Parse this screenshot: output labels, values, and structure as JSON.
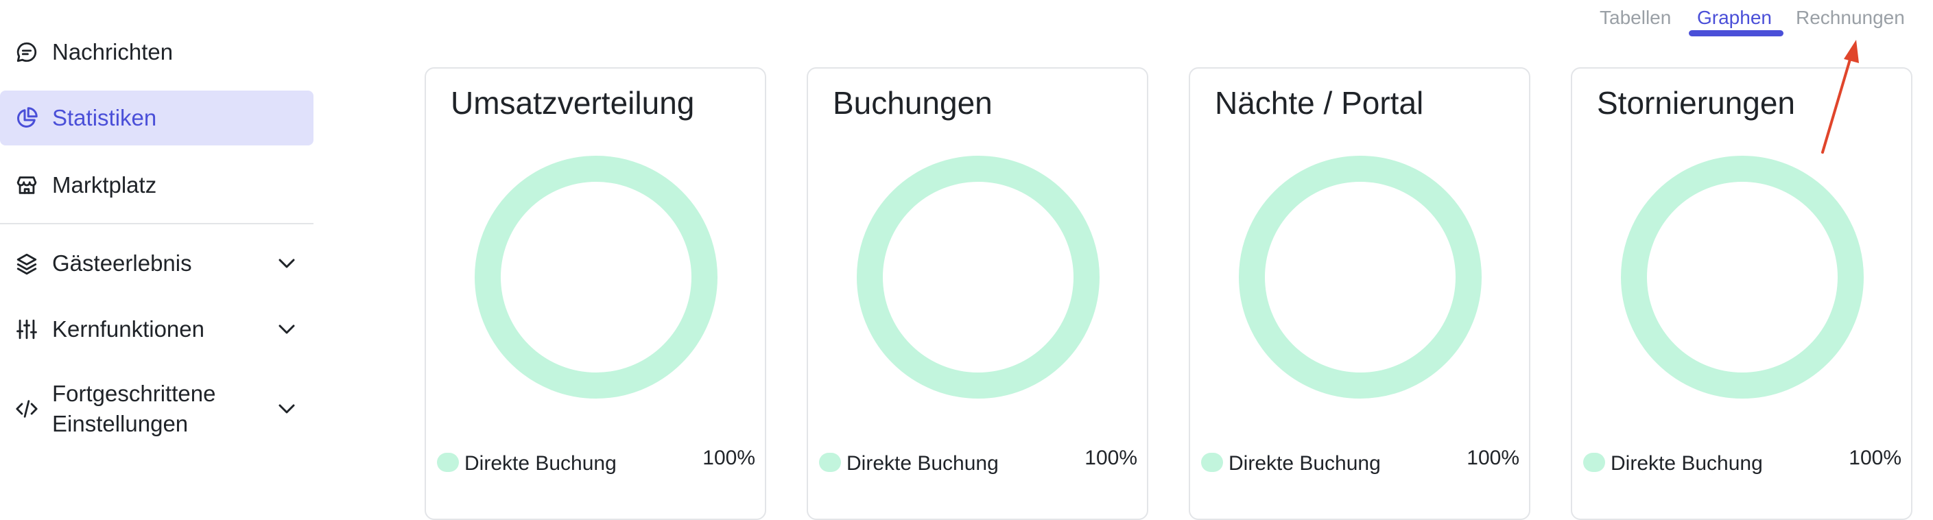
{
  "sidebar": {
    "items": [
      {
        "label": "Nachrichten",
        "icon": "chat-icon"
      },
      {
        "label": "Statistiken",
        "icon": "pie-chart-icon",
        "active": true
      },
      {
        "label": "Marktplatz",
        "icon": "store-icon"
      },
      {
        "label": "Gästeerlebnis",
        "icon": "layers-icon"
      },
      {
        "label": "Kernfunktionen",
        "icon": "sliders-icon"
      },
      {
        "label_line1": "Fortgeschrittene",
        "label_line2": "Einstellungen",
        "icon": "code-icon"
      }
    ]
  },
  "tabs": [
    {
      "label": "Tabellen"
    },
    {
      "label": "Graphen",
      "active": true
    },
    {
      "label": "Rechnungen"
    }
  ],
  "cards": [
    {
      "title": "Umsatzverteilung",
      "legend_label": "Direkte Buchung",
      "legend_value": "100%"
    },
    {
      "title": "Buchungen",
      "legend_label": "Direkte Buchung",
      "legend_value": "100%"
    },
    {
      "title": "Nächte / Portal",
      "legend_label": "Direkte Buchung",
      "legend_value": "100%"
    },
    {
      "title": "Stornierungen",
      "legend_label": "Direkte Buchung",
      "legend_value": "100%"
    }
  ],
  "colors": {
    "accent": "#4a4fd8",
    "active_bg": "#e0e1fb",
    "donut": "#c2f5dd",
    "annotation_arrow": "#e0452b"
  }
}
